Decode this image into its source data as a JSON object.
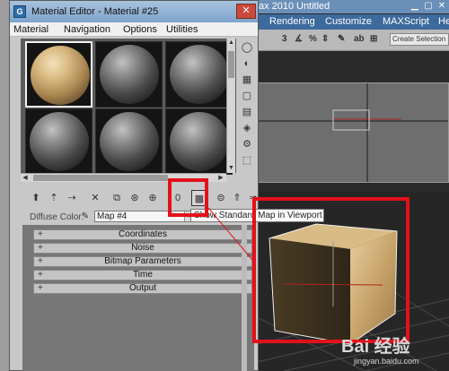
{
  "background_app": {
    "title_version": "ax 2010",
    "title_document": "Untitled",
    "menu": [
      "Rendering",
      "Customize",
      "MAXScript",
      "Help"
    ],
    "selection_set_placeholder": "Create Selection Se"
  },
  "material_editor": {
    "title": "Material Editor - Material #25",
    "menu": [
      "Material",
      "Navigation",
      "Options",
      "Utilities"
    ],
    "diffuse_label": "Diffuse Color:",
    "map_value": "Map #4",
    "tooltip": "Show Standard Map in Viewport",
    "rollouts": [
      "Coordinates",
      "Noise",
      "Bitmap Parameters",
      "Time",
      "Output"
    ],
    "rollout_marker": "+"
  },
  "watermark": {
    "brand": "Bai 经验",
    "url": "jingyan.baidu.com"
  }
}
